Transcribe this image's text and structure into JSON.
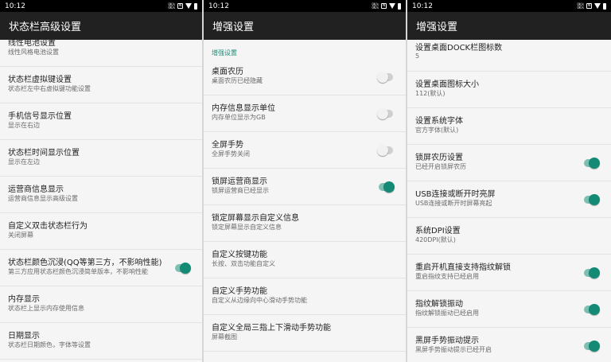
{
  "status_bar": {
    "time": "10:12",
    "net_top": "0K/s",
    "net_bottom": "0K/s",
    "nfc_glyph": "N"
  },
  "accent_color": "#128a74",
  "panel1": {
    "title": "状态栏高级设置",
    "items": [
      {
        "title": "线性电池设置",
        "sub": "线性风格电池设置"
      },
      {
        "title": "状态栏虚拟键设置",
        "sub": "状态栏左中右虚拟键功能设置"
      },
      {
        "title": "手机信号显示位置",
        "sub": "显示在右边"
      },
      {
        "title": "状态栏时间显示位置",
        "sub": "显示在左边"
      },
      {
        "title": "运营商信息显示",
        "sub": "运营商信息显示高级设置"
      },
      {
        "title": "自定义双击状态栏行为",
        "sub": "关闭屏幕"
      },
      {
        "title": "状态栏颜色沉浸(QQ等第三方，不影响性能)",
        "sub": "第三方应用状态栏颜色沉浸简单版本，不影响性能",
        "switch": true
      },
      {
        "title": "内存显示",
        "sub": "状态栏上显示内存使用信息"
      },
      {
        "title": "日期显示",
        "sub": "状态栏日期颜色，字体等设置"
      }
    ]
  },
  "panel2": {
    "title": "增强设置",
    "section": "增强设置",
    "items": [
      {
        "title": "桌面农历",
        "sub": "桌面农历已经隐藏",
        "switch": false
      },
      {
        "title": "内存信息显示单位",
        "sub": "内存单位显示为GB",
        "switch": false
      },
      {
        "title": "全屏手势",
        "sub": "全屏手势关闭",
        "switch": false
      },
      {
        "title": "锁屏运营商显示",
        "sub": "锁屏运营商已经显示",
        "switch": true
      },
      {
        "title": "锁定屏幕显示自定义信息",
        "sub": "锁定屏幕显示自定义信息"
      },
      {
        "title": "自定义按键功能",
        "sub": "长按、双击功能自定义"
      },
      {
        "title": "自定义手势功能",
        "sub": "自定义从边缘向中心滑动手势功能"
      },
      {
        "title": "自定义全局三指上下滑动手势功能",
        "sub": "屏幕截图"
      }
    ]
  },
  "panel3": {
    "title": "增强设置",
    "items": [
      {
        "title": "设置桌面DOCK栏图标数",
        "sub": "5"
      },
      {
        "title": "设置桌面图标大小",
        "sub": "112(默认)"
      },
      {
        "title": "设置系统字体",
        "sub": "官方字体(默认)"
      },
      {
        "title": "锁屏农历设置",
        "sub": "已经开启锁屏农历",
        "switch": true
      },
      {
        "title": "USB连接或断开时亮屏",
        "sub": "USB连接或断开时屏幕亮起",
        "switch": true
      },
      {
        "title": "系统DPI设置",
        "sub": "420DPI(默认)"
      },
      {
        "title": "重启开机直接支持指纹解锁",
        "sub": "重启指纹支持已经启用",
        "switch": true
      },
      {
        "title": "指纹解锁振动",
        "sub": "指纹解锁振动已经启用",
        "switch": true
      },
      {
        "title": "黑屏手势振动提示",
        "sub": "黑屏手势振动提示已经开启",
        "switch": true
      }
    ]
  }
}
